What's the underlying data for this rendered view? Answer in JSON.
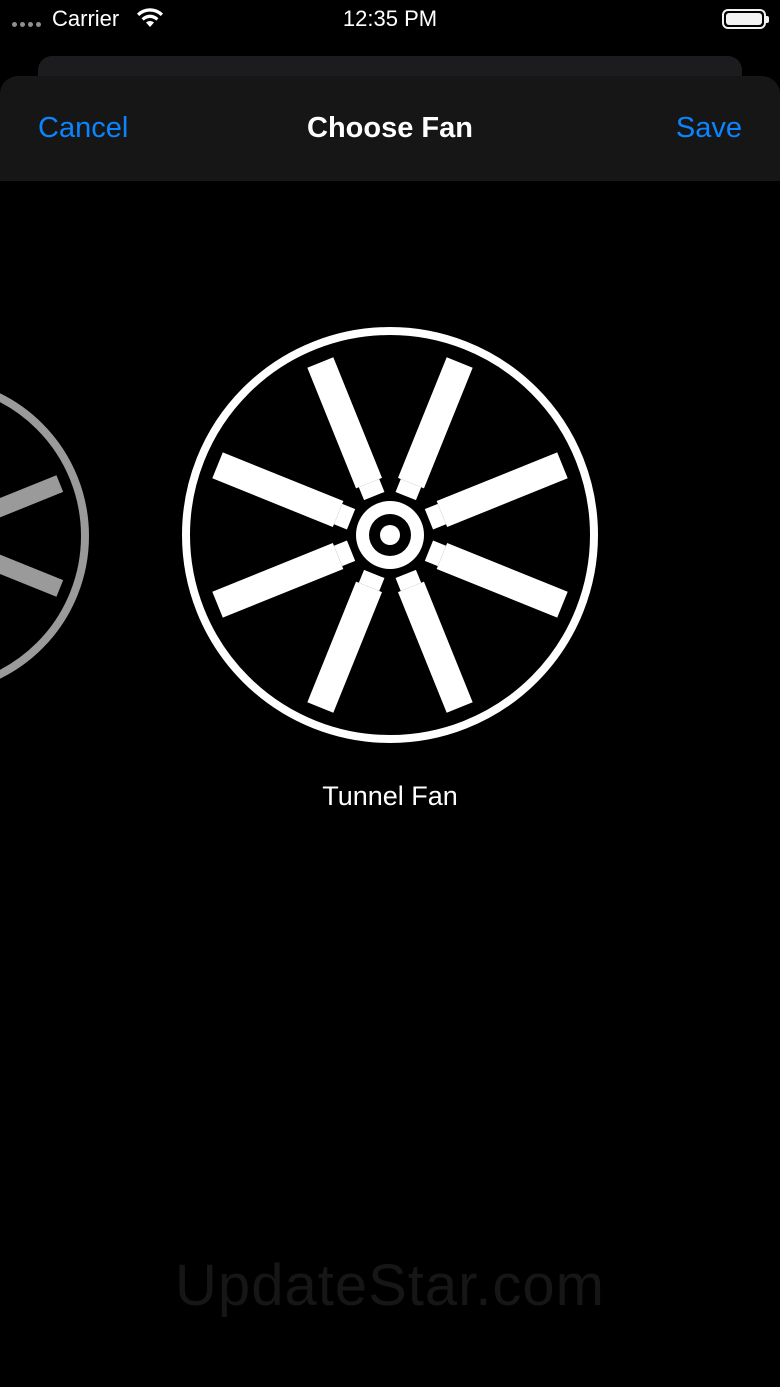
{
  "status_bar": {
    "carrier": "Carrier",
    "time": "12:35 PM",
    "wifi_icon": "wifi-icon",
    "battery_icon": "battery-full-icon"
  },
  "nav": {
    "cancel_label": "Cancel",
    "title": "Choose Fan",
    "save_label": "Save"
  },
  "carousel": {
    "selected_label": "Tunnel Fan",
    "items_visible": 3,
    "fan_icon": "tunnel-fan-icon"
  },
  "watermark": "UpdateStar.com",
  "colors": {
    "accent": "#0a84ff",
    "background": "#000000",
    "nav_background": "#161616",
    "fan_selected": "#ffffff",
    "fan_unselected": "#9a9a9a"
  }
}
